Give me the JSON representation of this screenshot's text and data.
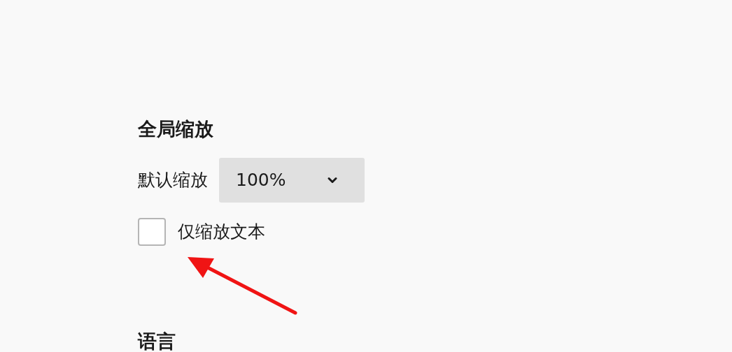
{
  "zoom_section": {
    "title": "全局缩放",
    "default_zoom": {
      "label": "默认缩放",
      "value": "100%"
    },
    "text_only": {
      "label": "仅缩放文本",
      "checked": false
    }
  },
  "language_section": {
    "title": "语言"
  }
}
